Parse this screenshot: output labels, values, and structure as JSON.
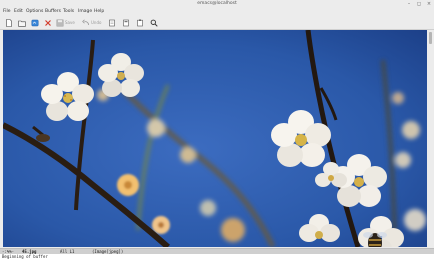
{
  "window": {
    "title": "emacs@localhost"
  },
  "menu": [
    "File",
    "Edit",
    "Options",
    "Buffers",
    "Tools",
    "Image",
    "Help"
  ],
  "toolbar": {
    "save_label": "Save",
    "undo_label": "Undo"
  },
  "modeline": {
    "status": "-:%%-",
    "buffer_name": "45.jpg",
    "position": "All L1",
    "mode": "(Image[jpeg])"
  },
  "minibuffer": {
    "message": "Beginning of buffer"
  },
  "colors": {
    "sky": "#2a58a8",
    "blossom": "#f4f0ea",
    "branch": "#2a1d12"
  }
}
